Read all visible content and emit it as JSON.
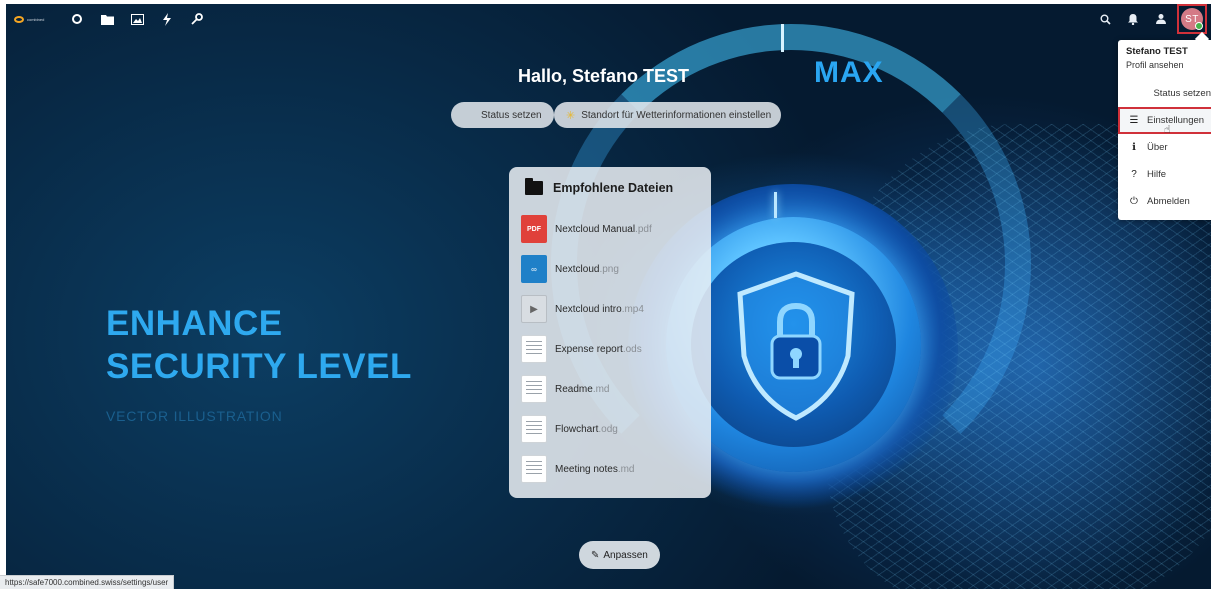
{
  "topbar": {
    "logo_text": "combined",
    "apps": [
      {
        "name": "dashboard-icon",
        "glyph": "○"
      },
      {
        "name": "files-icon",
        "glyph": "▬"
      },
      {
        "name": "photos-icon",
        "glyph": "▣"
      },
      {
        "name": "activity-icon",
        "glyph": "ϟ"
      },
      {
        "name": "passwords-icon",
        "glyph": "🔑"
      }
    ],
    "right": {
      "search_glyph": "⌕",
      "notifications_glyph": "🔔",
      "contacts_glyph": "👤",
      "avatar_initials": "ST"
    }
  },
  "background": {
    "max_label": "MAX",
    "hero_line1": "ENHANCE",
    "hero_line2": "SECURITY LEVEL",
    "hero_sub": "VECTOR ILLUSTRATION"
  },
  "dashboard": {
    "greeting": "Hallo, Stefano TEST",
    "status_button": "Status setzen",
    "weather_button": "Standort für Wetterinformationen einstellen",
    "customize_button": "Anpassen"
  },
  "recommended": {
    "title": "Empfohlene Dateien",
    "files": [
      {
        "base": "Nextcloud Manual",
        "ext": ".pdf",
        "type": "pdf",
        "thumb_label": "PDF"
      },
      {
        "base": "Nextcloud",
        "ext": ".png",
        "type": "png",
        "thumb_label": "∞"
      },
      {
        "base": "Nextcloud intro",
        "ext": ".mp4",
        "type": "mp4",
        "thumb_label": "▶"
      },
      {
        "base": "Expense report",
        "ext": ".ods",
        "type": "doc",
        "thumb_label": ""
      },
      {
        "base": "Readme",
        "ext": ".md",
        "type": "doc",
        "thumb_label": ""
      },
      {
        "base": "Flowchart",
        "ext": ".odg",
        "type": "doc",
        "thumb_label": ""
      },
      {
        "base": "Meeting notes",
        "ext": ".md",
        "type": "doc",
        "thumb_label": ""
      }
    ]
  },
  "user_menu": {
    "name": "Stefano TEST",
    "profile_link": "Profil ansehen",
    "status": "Status setzen",
    "settings": "Einstellungen",
    "about": "Über",
    "help": "Hilfe",
    "logout": "Abmelden",
    "settings_glyph": "☰",
    "about_glyph": "ℹ",
    "help_glyph": "?",
    "logout_glyph": "⏻"
  },
  "status_bar": {
    "url": "https://safe7000.combined.swiss/settings/user"
  },
  "colors": {
    "accent_blue": "#2ea9ef",
    "highlight_red": "#d0313a",
    "logo_orange": "#f5a623"
  }
}
